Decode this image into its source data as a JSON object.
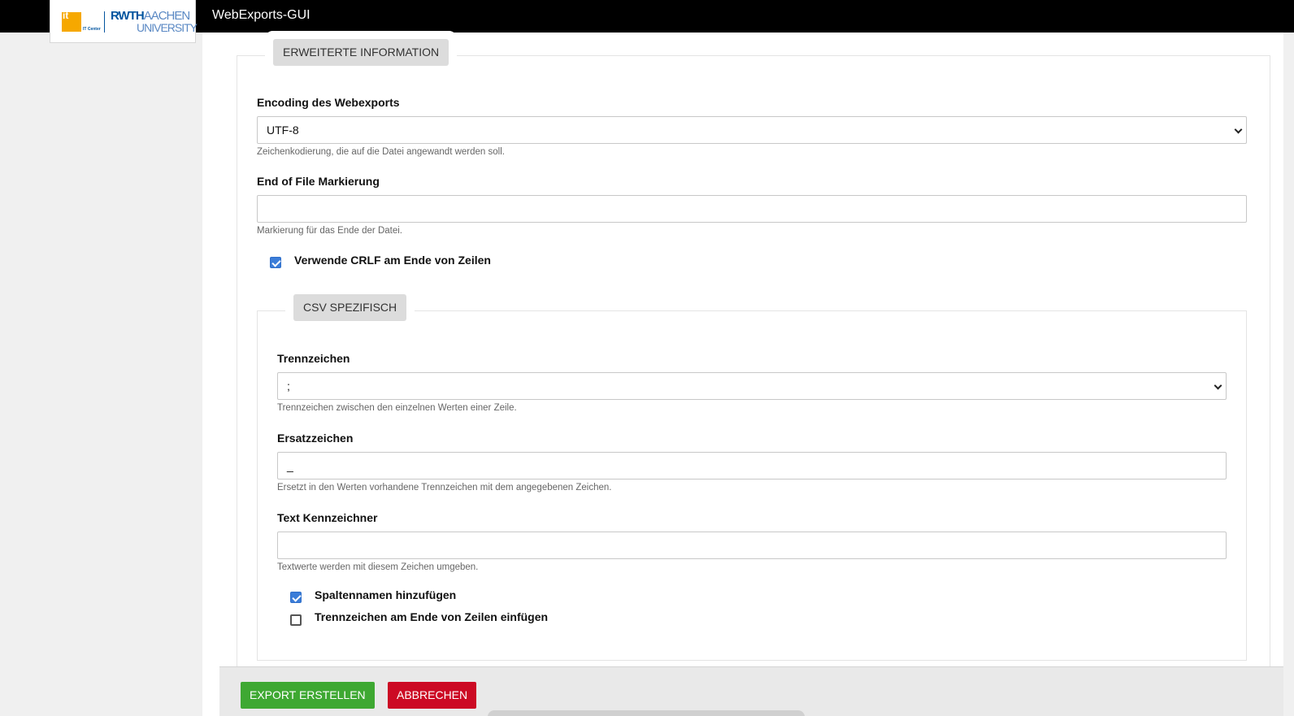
{
  "app": {
    "title": "WebExports-GUI"
  },
  "logo": {
    "it": "it",
    "it_sub": "IT Center",
    "rwth": "RWTH",
    "aachen": "AACHEN",
    "university": "UNIVERSITY"
  },
  "extended": {
    "legend": "ERWEITERTE INFORMATION",
    "encoding": {
      "label": "Encoding des Webexports",
      "value": "UTF-8",
      "help": "Zeichenkodierung, die auf die Datei angewandt werden soll."
    },
    "eof": {
      "label": "End of File Markierung",
      "value": "",
      "help": "Markierung für das Ende der Datei."
    },
    "crlf": {
      "label": "Verwende CRLF am Ende von Zeilen",
      "checked": true
    }
  },
  "csv": {
    "legend": "CSV SPEZIFISCH",
    "separator": {
      "label": "Trennzeichen",
      "value": ";",
      "help": "Trennzeichen zwischen den einzelnen Werten einer Zeile."
    },
    "replacement": {
      "label": "Ersatzzeichen",
      "value": "_",
      "help": "Ersetzt in den Werten vorhandene Trennzeichen mit dem angegebenen Zeichen."
    },
    "text_qualifier": {
      "label": "Text Kennzeichner",
      "value": "",
      "help": "Textwerte werden mit diesem Zeichen umgeben."
    },
    "add_columns": {
      "label": "Spaltennamen hinzufügen",
      "checked": true
    },
    "trailing_separator": {
      "label": "Trennzeichen am Ende von Zeilen einfügen",
      "checked": false
    }
  },
  "footer": {
    "export_label": "EXPORT ERSTELLEN",
    "cancel_label": "ABBRECHEN"
  },
  "colors": {
    "export": "#3ea832",
    "cancel": "#cc0a24",
    "checkbox": "#3b7dd8",
    "logo_blue": "#00549f",
    "logo_orange": "#f6a800"
  }
}
